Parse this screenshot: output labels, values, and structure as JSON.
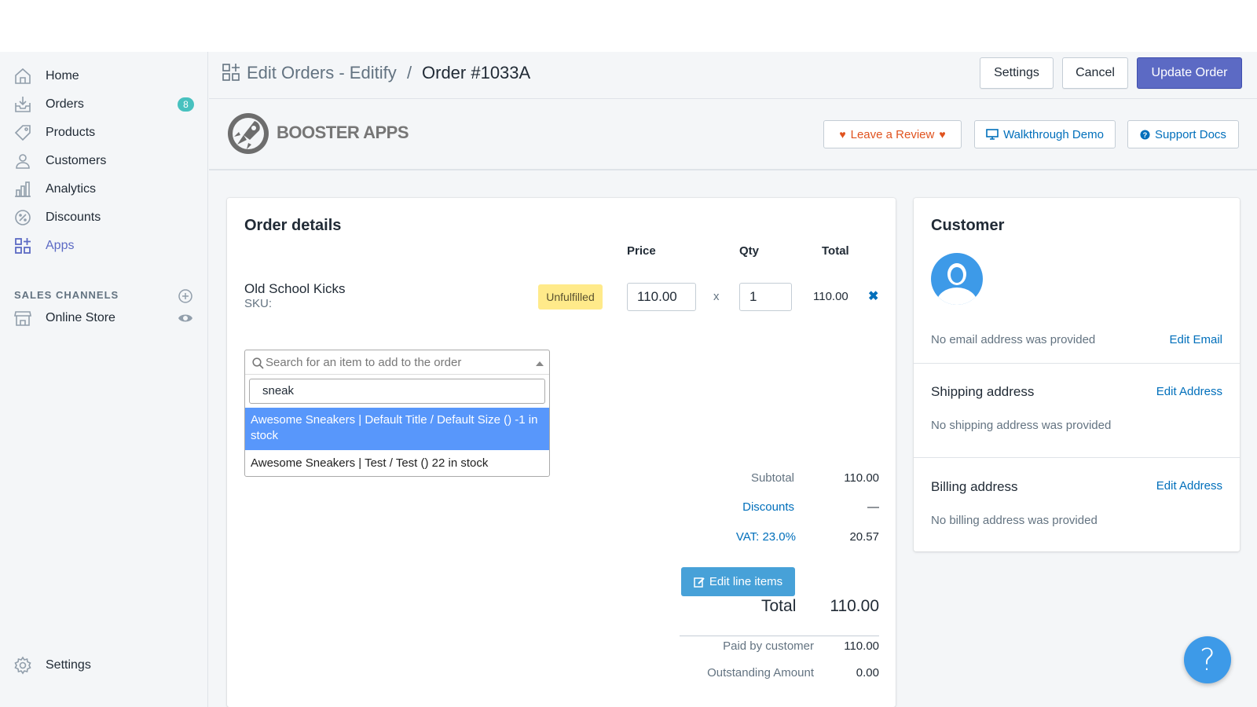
{
  "sidebar": {
    "items": [
      {
        "label": "Home",
        "icon": "home-icon"
      },
      {
        "label": "Orders",
        "icon": "orders-icon",
        "badge": "8"
      },
      {
        "label": "Products",
        "icon": "tag-icon"
      },
      {
        "label": "Customers",
        "icon": "person-icon"
      },
      {
        "label": "Analytics",
        "icon": "bar-chart-icon"
      },
      {
        "label": "Discounts",
        "icon": "discount-icon"
      },
      {
        "label": "Apps",
        "icon": "apps-icon",
        "active": true
      }
    ],
    "sales_channels_heading": "SALES CHANNELS",
    "online_store": "Online Store",
    "settings": "Settings"
  },
  "header": {
    "app_name": "Edit Orders - Editify",
    "separator": "/",
    "order_title": "Order #1033A",
    "settings_button": "Settings",
    "cancel_button": "Cancel",
    "update_button": "Update Order"
  },
  "booster": {
    "logo_text": "BOOSTER APPS",
    "review_button": "Leave a Review",
    "demo_button": "Walkthrough Demo",
    "docs_button": "Support Docs"
  },
  "order": {
    "title": "Order details",
    "columns": {
      "price": "Price",
      "qty": "Qty",
      "total": "Total"
    },
    "line_item": {
      "name": "Old School Kicks",
      "sku": "SKU:",
      "status": "Unfulfilled",
      "price": "110.00",
      "times": "x",
      "qty": "1",
      "total": "110.00"
    },
    "search": {
      "placeholder": "Search for an item to add to the order",
      "query": "sneak",
      "options": [
        "Awesome Sneakers | Default Title / Default Size () -1 in stock",
        "Awesome Sneakers | Test / Test () 22 in stock"
      ]
    },
    "totals": {
      "subtotal_label": "Subtotal",
      "subtotal": "110.00",
      "discounts_label": "Discounts",
      "discounts": "—",
      "vat_label": "VAT:",
      "vat_rate": "23.0%",
      "vat": "20.57",
      "edit_button": "Edit line items",
      "total_label": "Total",
      "total": "110.00",
      "paid_label": "Paid by customer",
      "paid": "110.00",
      "outstanding_label": "Outstanding Amount",
      "outstanding": "0.00"
    }
  },
  "customer": {
    "title": "Customer",
    "no_email": "No email address was provided",
    "edit_email": "Edit Email",
    "shipping_title": "Shipping address",
    "edit_shipping": "Edit Address",
    "no_shipping": "No shipping address was provided",
    "billing_title": "Billing address",
    "edit_billing": "Edit Address",
    "no_billing": "No billing address was provided"
  },
  "help_button": "?",
  "colors": {
    "primary": "#5c6ac4",
    "link": "#006fbb",
    "badge": "#47c1bf",
    "highlight": "#5897fb",
    "review": "#e0531f",
    "unfulfilled": "#ffea8a"
  }
}
